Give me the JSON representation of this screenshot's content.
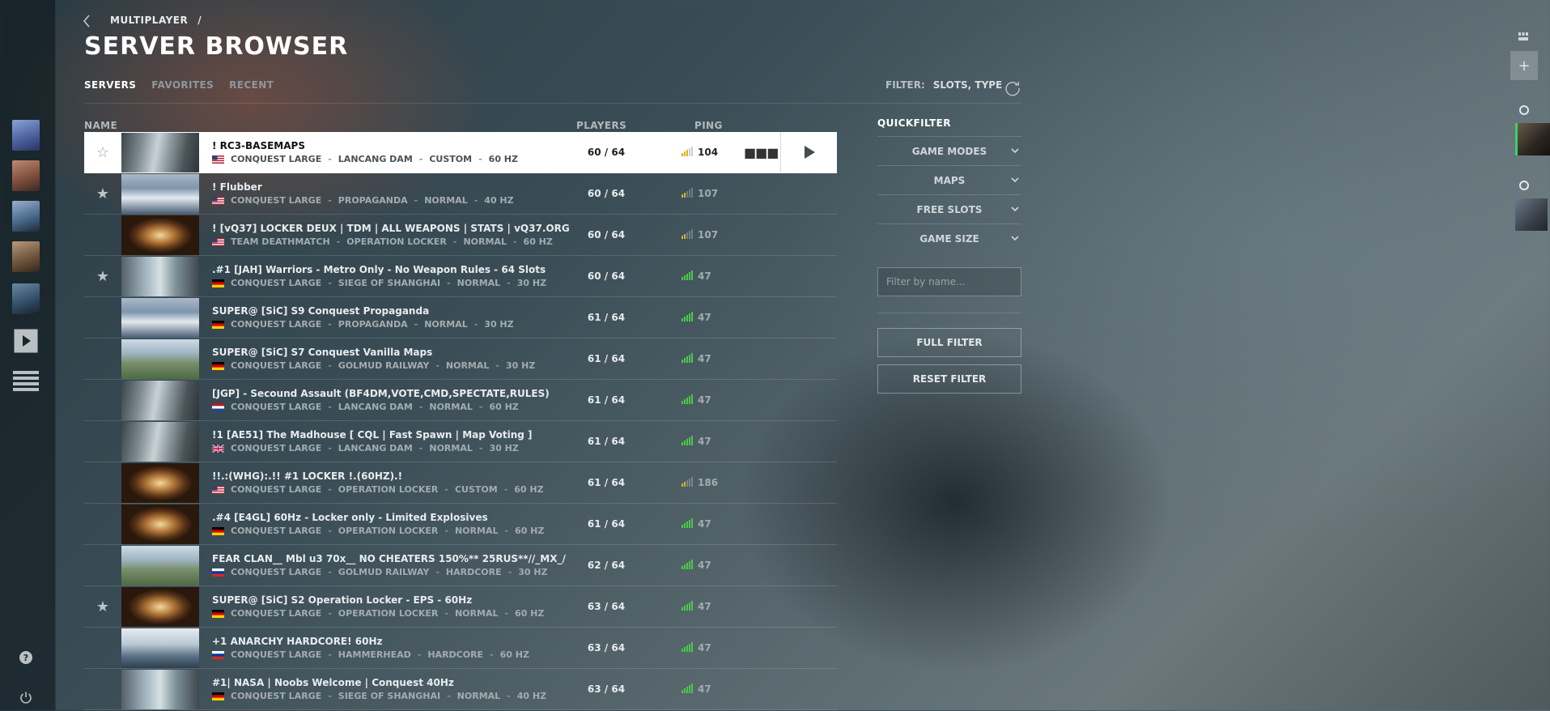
{
  "breadcrumb": {
    "parent": "MULTIPLAYER",
    "separator": "/"
  },
  "title": "SERVER BROWSER",
  "tabs": [
    {
      "label": "SERVERS",
      "active": true
    },
    {
      "label": "FAVORITES",
      "active": false
    },
    {
      "label": "RECENT",
      "active": false
    }
  ],
  "filter": {
    "label": "FILTER:",
    "value": "SLOTS, TYPE"
  },
  "columns": {
    "name": "NAME",
    "players": "PLAYERS",
    "ping": "PING"
  },
  "servers": [
    {
      "name": "! RC3-BASEMAPS",
      "flag": "us",
      "mode": "CONQUEST LARGE",
      "map": "LANCANG DAM",
      "preset": "CUSTOM",
      "tick": "60 HZ",
      "players": "60 / 64",
      "ping": "104",
      "ping_level": 3,
      "ping_color": "#e0b020",
      "favorite": false,
      "selected": true,
      "thumb": "dam"
    },
    {
      "name": "! Flubber",
      "flag": "us",
      "mode": "CONQUEST LARGE",
      "map": "PROPAGANDA",
      "preset": "NORMAL",
      "tick": "40 HZ",
      "players": "60 / 64",
      "ping": "107",
      "ping_level": 2,
      "ping_color": "#e0b020",
      "favorite": true,
      "selected": false,
      "thumb": "snow"
    },
    {
      "name": "! [vQ37] LOCKER DEUX | TDM | ALL WEAPONS | STATS | vQ37.ORG",
      "flag": "us",
      "mode": "TEAM DEATHMATCH",
      "map": "OPERATION LOCKER",
      "preset": "NORMAL",
      "tick": "60 HZ",
      "players": "60 / 64",
      "ping": "107",
      "ping_level": 2,
      "ping_color": "#e0b020",
      "favorite": null,
      "selected": false,
      "thumb": "locker"
    },
    {
      "name": ".#1 [JAH] Warriors - Metro Only - No Weapon Rules - 64 Slots",
      "flag": "de",
      "mode": "CONQUEST LARGE",
      "map": "SIEGE OF SHANGHAI",
      "preset": "NORMAL",
      "tick": "30 HZ",
      "players": "60 / 64",
      "ping": "47",
      "ping_level": 5,
      "ping_color": "#4cc84c",
      "favorite": true,
      "selected": false,
      "thumb": "city"
    },
    {
      "name": "SUPER@ [SiC] S9 Conquest Propaganda",
      "flag": "de",
      "mode": "CONQUEST LARGE",
      "map": "PROPAGANDA",
      "preset": "NORMAL",
      "tick": "30 HZ",
      "players": "61 / 64",
      "ping": "47",
      "ping_level": 5,
      "ping_color": "#4cc84c",
      "favorite": null,
      "selected": false,
      "thumb": "snow"
    },
    {
      "name": "SUPER@ [SiC] S7 Conquest Vanilla Maps",
      "flag": "de",
      "mode": "CONQUEST LARGE",
      "map": "GOLMUD RAILWAY",
      "preset": "NORMAL",
      "tick": "30 HZ",
      "players": "61 / 64",
      "ping": "47",
      "ping_level": 5,
      "ping_color": "#4cc84c",
      "favorite": null,
      "selected": false,
      "thumb": "field"
    },
    {
      "name": "[JGP] - Secound Assault (BF4DM,VOTE,CMD,SPECTATE,RULES)",
      "flag": "nl",
      "mode": "CONQUEST LARGE",
      "map": "LANCANG DAM",
      "preset": "NORMAL",
      "tick": "60 HZ",
      "players": "61 / 64",
      "ping": "47",
      "ping_level": 5,
      "ping_color": "#4cc84c",
      "favorite": null,
      "selected": false,
      "thumb": "dam"
    },
    {
      "name": "!1 [AE51] The Madhouse [ CQL | Fast Spawn | Map Voting ]",
      "flag": "gb",
      "mode": "CONQUEST LARGE",
      "map": "LANCANG DAM",
      "preset": "NORMAL",
      "tick": "30 HZ",
      "players": "61 / 64",
      "ping": "47",
      "ping_level": 5,
      "ping_color": "#4cc84c",
      "favorite": null,
      "selected": false,
      "thumb": "dam"
    },
    {
      "name": "!!.:(WHG):.!! #1 LOCKER !.(60HZ).!",
      "flag": "us",
      "mode": "CONQUEST LARGE",
      "map": "OPERATION LOCKER",
      "preset": "CUSTOM",
      "tick": "60 HZ",
      "players": "61 / 64",
      "ping": "186",
      "ping_level": 2,
      "ping_color": "#e0b020",
      "favorite": null,
      "selected": false,
      "thumb": "locker"
    },
    {
      "name": ".#4 [E4GL] 60Hz - Locker only - Limited Explosives",
      "flag": "de",
      "mode": "CONQUEST LARGE",
      "map": "OPERATION LOCKER",
      "preset": "NORMAL",
      "tick": "60 HZ",
      "players": "61 / 64",
      "ping": "47",
      "ping_level": 5,
      "ping_color": "#4cc84c",
      "favorite": null,
      "selected": false,
      "thumb": "locker"
    },
    {
      "name": "FEAR CLAN__ Mbl u3 70x__ NO CHEATERS 150%** 25RUS**//_MX_/",
      "flag": "ru",
      "mode": "CONQUEST LARGE",
      "map": "GOLMUD RAILWAY",
      "preset": "HARDCORE",
      "tick": "30 HZ",
      "players": "62 / 64",
      "ping": "47",
      "ping_level": 5,
      "ping_color": "#4cc84c",
      "favorite": null,
      "selected": false,
      "thumb": "field"
    },
    {
      "name": "SUPER@ [SiC] S2 Operation Locker - EPS - 60Hz",
      "flag": "de",
      "mode": "CONQUEST LARGE",
      "map": "OPERATION LOCKER",
      "preset": "NORMAL",
      "tick": "60 HZ",
      "players": "63 / 64",
      "ping": "47",
      "ping_level": 5,
      "ping_color": "#4cc84c",
      "favorite": true,
      "selected": false,
      "thumb": "locker"
    },
    {
      "name": "+1 ANARCHY HARDCORE! 60Hz",
      "flag": "ru",
      "mode": "CONQUEST LARGE",
      "map": "HAMMERHEAD",
      "preset": "HARDCORE",
      "tick": "60 HZ",
      "players": "63 / 64",
      "ping": "47",
      "ping_level": 5,
      "ping_color": "#4cc84c",
      "favorite": null,
      "selected": false,
      "thumb": "sea"
    },
    {
      "name": "#1| NASA | Noobs Welcome | Conquest 40Hz",
      "flag": "de",
      "mode": "CONQUEST LARGE",
      "map": "SIEGE OF SHANGHAI",
      "preset": "NORMAL",
      "tick": "40 HZ",
      "players": "63 / 64",
      "ping": "47",
      "ping_level": 5,
      "ping_color": "#4cc84c",
      "favorite": null,
      "selected": false,
      "thumb": "city"
    }
  ],
  "quickfilter": {
    "title": "QUICKFILTER",
    "items": [
      "GAME MODES",
      "MAPS",
      "FREE SLOTS",
      "GAME SIZE"
    ],
    "search_placeholder": "Filter by name...",
    "full_filter": "FULL FILTER",
    "reset_filter": "RESET FILTER"
  },
  "icons": {
    "back": "chevron-left-icon",
    "refresh": "refresh-icon",
    "play": "play-icon",
    "help": "help-icon",
    "power": "power-icon",
    "menu": "menu-icon",
    "more": "more-icon",
    "star": "star-icon"
  }
}
